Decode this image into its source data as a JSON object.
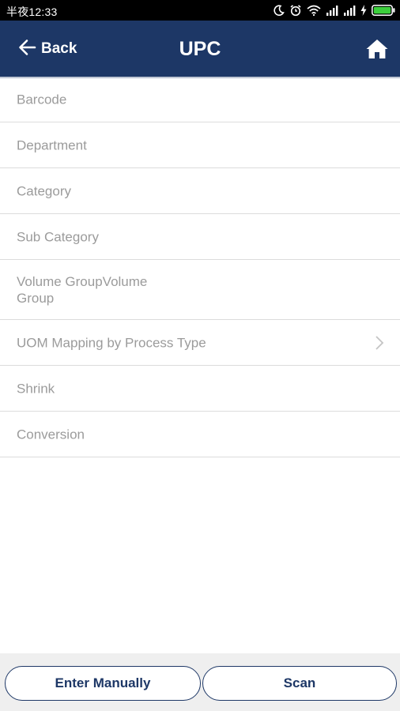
{
  "status_bar": {
    "time": "半夜12:33",
    "icons": [
      "moon-icon",
      "alarm-icon",
      "wifi-icon",
      "signal-icon",
      "signal-icon",
      "charging-icon",
      "battery-icon"
    ]
  },
  "header": {
    "back_label": "Back",
    "title": "UPC",
    "home_icon": "home-icon",
    "background_color": "#1d3766"
  },
  "list": {
    "items": [
      {
        "label": "Barcode",
        "has_chevron": false
      },
      {
        "label": "Department",
        "has_chevron": false
      },
      {
        "label": "Category",
        "has_chevron": false
      },
      {
        "label": "Sub Category",
        "has_chevron": false
      },
      {
        "label": "Volume GroupVolume Group",
        "has_chevron": false
      },
      {
        "label": "UOM Mapping by Process Type",
        "has_chevron": true
      },
      {
        "label": "Shrink",
        "has_chevron": false
      },
      {
        "label": "Conversion",
        "has_chevron": false
      }
    ]
  },
  "footer": {
    "enter_manually_label": "Enter Manually",
    "scan_label": "Scan"
  }
}
